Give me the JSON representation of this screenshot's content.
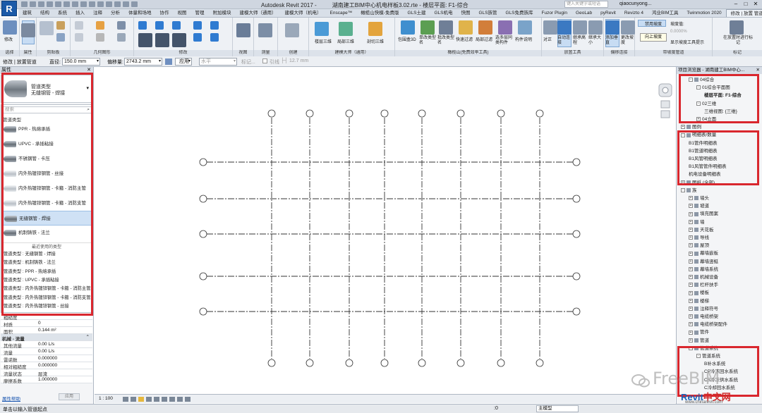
{
  "titlebar": {
    "app": "Autodesk Revit 2017 -",
    "file": "湖南建工BIM中心机电样板3.02.rte - 楼层平面: F1-综合",
    "search_placeholder": "键入关键字或短语",
    "user": "qiaocunyong...",
    "logo": "R"
  },
  "ribbon_tabs": [
    "建筑",
    "结构",
    "系统",
    "插入",
    "注释",
    "分析",
    "体量和场地",
    "协作",
    "视图",
    "管理",
    "附加模块",
    "建模大师（通用）",
    "建模大师（机电）",
    "Enscape™",
    "橄榄山快模-免费版",
    "GLS土建",
    "GLS机电",
    "快图",
    "GLS族管",
    "GLS免费族库",
    "Fuzor Plugin",
    "GeoLab",
    "pyRevit",
    "Revizto 4",
    "鸿业BIM工具",
    "Twinmotion 2020",
    "修改 | 放置 管道"
  ],
  "ribbon": {
    "modify": "修改",
    "select": "选择",
    "props": "属性",
    "clipboard": "剪贴板",
    "geometry": "几何图形",
    "modify_panel": "修改",
    "view": "视图",
    "measure": "测量",
    "create": "创建",
    "jianmo": "建模大师（通用）",
    "ganlan": "橄榄山(免费效率工具)",
    "placement": "放置工具",
    "offset_conn": "偏移连接",
    "slope_panel": "带坡度管道",
    "tag_panel": "标记",
    "buttons": [
      "楼层三维",
      "局部三维",
      "剖切三维",
      "包围盒3D",
      "单改类型名",
      "批改类型名",
      "快速过滤",
      "局部过滤",
      "选多层同类构件",
      "构件说明",
      "对正",
      "自动连接",
      "继承高程",
      "继承大小",
      "添加垂直",
      "更改坡度",
      "禁用坡度",
      "坡度值:",
      "0.0000%",
      "显示坡度工具提示",
      "在放置时进行标记"
    ],
    "tooltip": "向上坡度"
  },
  "optbar": {
    "mode": "修改 | 放置管道",
    "diameter_label": "直径:",
    "diameter": "150.0 mm",
    "offset_label": "偏移量:",
    "offset": "2743.2 mm",
    "apply": "应用",
    "level": "水平",
    "tag_label": "标记...",
    "lead_label": "引线",
    "len": "12.7 mm"
  },
  "props": {
    "header": "属性",
    "type_name_l1": "管道类型",
    "type_name_l2": "无缝钢管 - 焊接",
    "search_placeholder": "搜索",
    "group": "管道类型",
    "items": [
      "PPR - 热熔承插",
      "UPVC - 承插粘接",
      "不锈钢管 - 卡压",
      "内外热镀锌钢管 - 丝接",
      "内外热镀锌钢管 - 卡箍 - 消防主管",
      "内外热镀锌钢管 - 卡箍 - 消防支管",
      "无缝钢管 - 焊接",
      "机制铸铁 - 法兰"
    ],
    "recent_label": "最近使用的类型",
    "recent": [
      "管道类型 : 无缝钢管 - 焊接",
      "管道类型 : 机制铸铁 - 法兰",
      "管道类型 : PPR - 热熔承插",
      "管道类型 : UPVC - 承插粘接",
      "管道类型 : 内外热镀锌钢管 - 卡箍 - 消防主管",
      "管道类型 : 内外热镀锌钢管 - 卡箍 - 消防支管",
      "管道类型 : 内外热镀锌钢管 - 丝接"
    ],
    "rows": [
      {
        "k": "粗糙度",
        "v": ""
      },
      {
        "k": "材质",
        "v": "0"
      },
      {
        "k": "面积",
        "v": "0.144 m²"
      }
    ],
    "section": "机械 - 流量",
    "rows2": [
      {
        "k": "其他流量",
        "v": "0.00 L/s"
      },
      {
        "k": "流量",
        "v": "0.00 L/s"
      },
      {
        "k": "雷诺数",
        "v": "0.000000"
      },
      {
        "k": "相对粗糙度",
        "v": "0.000000"
      },
      {
        "k": "流量状态",
        "v": "层流"
      },
      {
        "k": "摩擦系数",
        "v": "1.000000"
      }
    ],
    "help_link": "属性帮助",
    "apply": "应用"
  },
  "browser": {
    "header": "项目浏览器 - 湖南建工BIM中心...",
    "tree": [
      {
        "t": "04综合",
        "lvl": 1,
        "exp": "-"
      },
      {
        "t": "01综合平面图",
        "lvl": 2,
        "exp": "-"
      },
      {
        "t": "楼层平面: F1-综合",
        "lvl": 3,
        "bold": true
      },
      {
        "t": "02三维",
        "lvl": 2,
        "exp": "-"
      },
      {
        "t": "三维视图: {三维}",
        "lvl": 3
      },
      {
        "t": "04立面",
        "lvl": 2,
        "exp": "+"
      },
      {
        "t": "图例",
        "lvl": 0,
        "exp": "+"
      },
      {
        "t": "明细表/数量",
        "lvl": 0,
        "exp": "-"
      },
      {
        "t": "B1管件明细表",
        "lvl": 1
      },
      {
        "t": "B1管道明细表",
        "lvl": 1
      },
      {
        "t": "B1风管明细表",
        "lvl": 1
      },
      {
        "t": "B1风管管件明细表",
        "lvl": 1
      },
      {
        "t": "机电设备明细表",
        "lvl": 1
      },
      {
        "t": "图纸 (全部)",
        "lvl": 0,
        "exp": "+"
      },
      {
        "t": "族",
        "lvl": 0,
        "exp": "-"
      },
      {
        "t": "墙头",
        "lvl": 1,
        "exp": "+"
      },
      {
        "t": "坡道",
        "lvl": 1,
        "exp": "+"
      },
      {
        "t": "填充图案",
        "lvl": 1,
        "exp": "+"
      },
      {
        "t": "墙",
        "lvl": 1,
        "exp": "+"
      },
      {
        "t": "天花板",
        "lvl": 1,
        "exp": "+"
      },
      {
        "t": "导线",
        "lvl": 1,
        "exp": "+"
      },
      {
        "t": "屋顶",
        "lvl": 1,
        "exp": "+"
      },
      {
        "t": "幕墙嵌板",
        "lvl": 1,
        "exp": "+"
      },
      {
        "t": "幕墙竖梃",
        "lvl": 1,
        "exp": "+"
      },
      {
        "t": "幕墙系统",
        "lvl": 1,
        "exp": "+"
      },
      {
        "t": "机械设备",
        "lvl": 1,
        "exp": "+"
      },
      {
        "t": "栏杆扶手",
        "lvl": 1,
        "exp": "+"
      },
      {
        "t": "楼板",
        "lvl": 1,
        "exp": "+"
      },
      {
        "t": "楼梯",
        "lvl": 1,
        "exp": "+"
      },
      {
        "t": "注释符号",
        "lvl": 1,
        "exp": "+"
      },
      {
        "t": "电缆桥架",
        "lvl": 1,
        "exp": "+"
      },
      {
        "t": "电缆桥架配件",
        "lvl": 1,
        "exp": "+"
      },
      {
        "t": "管件",
        "lvl": 1,
        "exp": "+"
      },
      {
        "t": "管道",
        "lvl": 1,
        "exp": "+"
      },
      {
        "t": "管道系统",
        "lvl": 1,
        "exp": "-"
      },
      {
        "t": "管道系统",
        "lvl": 2,
        "exp": "-"
      },
      {
        "t": "B补水系统",
        "lvl": 3
      },
      {
        "t": "CP冷冻回水系统",
        "lvl": 3
      },
      {
        "t": "CS冷冻供水系统",
        "lvl": 3
      },
      {
        "t": "C冷却回水系统",
        "lvl": 3
      }
    ]
  },
  "viewbar": {
    "scale": "1 : 100"
  },
  "status": {
    "text": "单击以输入管道起点",
    "model": "主模型",
    "zero": ":0"
  },
  "watermark": {
    "text": "FreeBIM",
    "brand1": "Revit",
    "brand2": "中文网",
    "url": "www.chinarevit.com"
  },
  "grid_labels": {
    "top": [
      "○",
      "○",
      "○",
      "○",
      "○",
      "○",
      "○",
      "○"
    ],
    "side": [
      "○",
      "○",
      "○",
      "○",
      "○",
      "○"
    ]
  }
}
